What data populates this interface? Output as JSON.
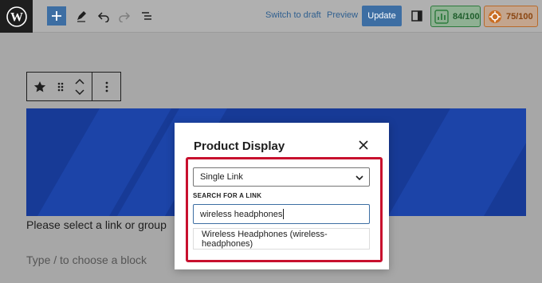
{
  "toolbar": {
    "switch_to_draft": "Switch to draft",
    "preview": "Preview",
    "update": "Update",
    "seo_score": "84/100",
    "readability_score": "75/100"
  },
  "canvas": {
    "select_message": "Please select a link or group",
    "block_placeholder": "Type / to choose a block"
  },
  "modal": {
    "title": "Product Display",
    "select_value": "Single Link",
    "search_label": "SEARCH FOR A LINK",
    "search_value": "wireless headphones",
    "result": "Wireless Headphones (wireless-headphones)"
  },
  "colors": {
    "accent": "#3d6ea3",
    "highlight": "#c8102e",
    "banner": "#173a96"
  },
  "icons": [
    "wordpress-logo-icon",
    "plus-icon",
    "pen-icon",
    "undo-icon",
    "redo-icon",
    "list-view-icon",
    "settings-panel-icon",
    "seo-score-icon",
    "readability-score-icon",
    "star-icon",
    "drag-handle-icon",
    "move-up-icon",
    "move-down-icon",
    "more-options-icon",
    "close-icon",
    "chevron-down-icon"
  ]
}
